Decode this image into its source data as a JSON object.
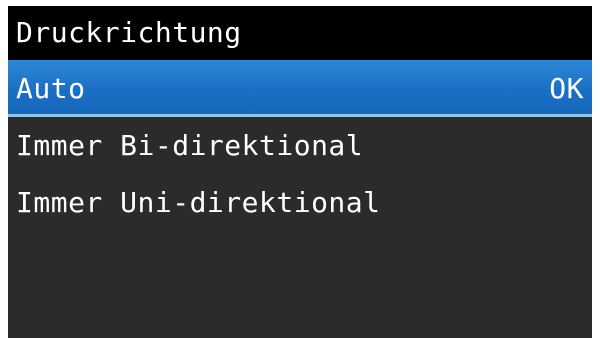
{
  "header": {
    "title": "Druckrichtung"
  },
  "menu": {
    "items": [
      {
        "label": "Auto",
        "status": "OK",
        "selected": true
      },
      {
        "label": "Immer Bi-direktional"
      },
      {
        "label": "Immer Uni-direktional"
      }
    ]
  },
  "colors": {
    "title_background": "#000000",
    "list_background": "#2b2b2b",
    "selection": "#1a6fc4",
    "text": "#ffffff"
  }
}
